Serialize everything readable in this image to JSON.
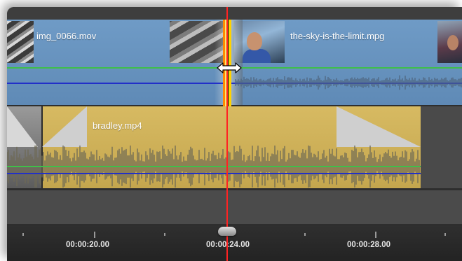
{
  "timeline": {
    "video_track": {
      "clips": [
        {
          "label": "img_0066.mov"
        },
        {
          "label": "the-sky-is-the-limit.mpg"
        }
      ]
    },
    "audio_track": {
      "clips": [
        {
          "label": "bradley.mp4"
        }
      ]
    },
    "ruler": {
      "timecodes": [
        "00:00:20.00",
        "00:00:24.00",
        "00:00:28.00"
      ]
    }
  },
  "colors": {
    "video_clip": "#6f9bc6",
    "audio_clip": "#d7ba62",
    "playhead": "#ff2323",
    "volume_line": "#3fbf4a",
    "pan_line": "#2230c8",
    "trim_edge": "#ffd200"
  },
  "icons": {
    "trim_cursor": "resize-horizontal-icon",
    "playhead_knob": "playhead-handle-icon"
  }
}
